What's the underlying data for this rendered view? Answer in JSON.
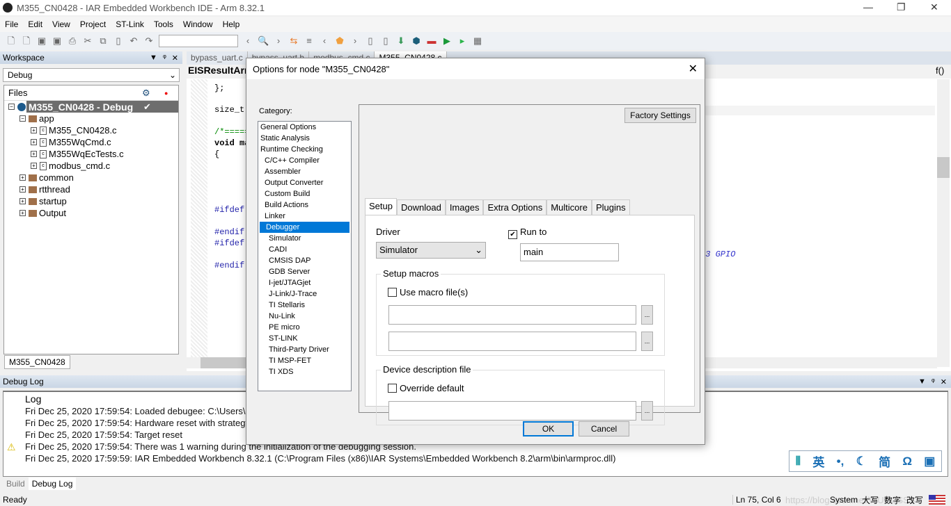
{
  "window": {
    "title": "M355_CN0428 - IAR Embedded Workbench IDE - Arm 8.32.1"
  },
  "menu": [
    "File",
    "Edit",
    "View",
    "Project",
    "ST-Link",
    "Tools",
    "Window",
    "Help"
  ],
  "workspace": {
    "title": "Workspace",
    "config": "Debug",
    "files_header": "Files",
    "tab": "M355_CN0428",
    "tree": [
      {
        "label": "M355_CN0428 - Debug",
        "level": 0,
        "kind": "project"
      },
      {
        "label": "app",
        "level": 1,
        "kind": "folder"
      },
      {
        "label": "M355_CN0428.c",
        "level": 2,
        "kind": "file"
      },
      {
        "label": "M355WqCmd.c",
        "level": 2,
        "kind": "file"
      },
      {
        "label": "M355WqEcTests.c",
        "level": 2,
        "kind": "file"
      },
      {
        "label": "modbus_cmd.c",
        "level": 2,
        "kind": "file"
      },
      {
        "label": "common",
        "level": 1,
        "kind": "folder"
      },
      {
        "label": "rtthread",
        "level": 1,
        "kind": "folder"
      },
      {
        "label": "startup",
        "level": 1,
        "kind": "folder"
      },
      {
        "label": "Output",
        "level": 1,
        "kind": "folder"
      }
    ]
  },
  "editor": {
    "tabs": [
      "bypass_uart.c",
      "bypass_uart.h",
      "modbus_cmd.c",
      "M355_CN0428.c"
    ],
    "function": "EISResultArrS",
    "code": [
      "};",
      "size_t",
      "/*=====",
      "void ma",
      "{",
      "#ifdef",
      "#endif",
      "#ifdef",
      "#endif"
    ],
    "comment_fragment": ".3 GPIO"
  },
  "dialog": {
    "title": "Options for node \"M355_CN0428\"",
    "category_label": "Category:",
    "categories": [
      {
        "label": "General Options",
        "indent": 0
      },
      {
        "label": "Static Analysis",
        "indent": 0
      },
      {
        "label": "Runtime Checking",
        "indent": 0
      },
      {
        "label": "C/C++ Compiler",
        "indent": 1
      },
      {
        "label": "Assembler",
        "indent": 1
      },
      {
        "label": "Output Converter",
        "indent": 1
      },
      {
        "label": "Custom Build",
        "indent": 1
      },
      {
        "label": "Build Actions",
        "indent": 1
      },
      {
        "label": "Linker",
        "indent": 1
      },
      {
        "label": "Debugger",
        "indent": 1,
        "selected": true
      },
      {
        "label": "Simulator",
        "indent": 2
      },
      {
        "label": "CADI",
        "indent": 2
      },
      {
        "label": "CMSIS DAP",
        "indent": 2
      },
      {
        "label": "GDB Server",
        "indent": 2
      },
      {
        "label": "I-jet/JTAGjet",
        "indent": 2
      },
      {
        "label": "J-Link/J-Trace",
        "indent": 2
      },
      {
        "label": "TI Stellaris",
        "indent": 2
      },
      {
        "label": "Nu-Link",
        "indent": 2
      },
      {
        "label": "PE micro",
        "indent": 2
      },
      {
        "label": "ST-LINK",
        "indent": 2
      },
      {
        "label": "Third-Party Driver",
        "indent": 2
      },
      {
        "label": "TI MSP-FET",
        "indent": 2
      },
      {
        "label": "TI XDS",
        "indent": 2
      }
    ],
    "factory_settings": "Factory Settings",
    "tabs": [
      "Setup",
      "Download",
      "Images",
      "Extra Options",
      "Multicore",
      "Plugins"
    ],
    "driver_label": "Driver",
    "driver_value": "Simulator",
    "run_to_label": "Run to",
    "run_to_checked": true,
    "run_to_value": "main",
    "setup_macros_label": "Setup macros",
    "use_macro_label": "Use macro file(s)",
    "use_macro_checked": false,
    "device_desc_label": "Device description file",
    "override_label": "Override default",
    "override_checked": false,
    "browse": "...",
    "ok": "OK",
    "cancel": "Cancel"
  },
  "debuglog": {
    "title": "Debug Log",
    "header": "Log",
    "lines": [
      {
        "text": "Fri Dec 25, 2020 17:59:54: Loaded debugee: C:\\Users\\",
        "warning": false
      },
      {
        "text": "Fri Dec 25, 2020 17:59:54: Hardware reset with strategy",
        "warning": false
      },
      {
        "text": "Fri Dec 25, 2020 17:59:54: Target reset",
        "warning": false
      },
      {
        "text": "Fri Dec 25, 2020 17:59:54: There was 1 warning during the initialization of the debugging session.",
        "warning": true
      },
      {
        "text": "Fri Dec 25, 2020 17:59:59: IAR Embedded Workbench 8.32.1 (C:\\Program Files (x86)\\IAR Systems\\Embedded Workbench 8.2\\arm\\bin\\armproc.dll)",
        "warning": false
      }
    ],
    "tabs": [
      "Build",
      "Debug Log"
    ]
  },
  "ime": {
    "items": [
      "英",
      "•,",
      "☾",
      "简",
      "Ω",
      "▣"
    ]
  },
  "status": {
    "ready": "Ready",
    "position": "Ln 75, Col 6",
    "encoding": "System",
    "caps": "大写",
    "num": "数字",
    "ovr": "改写",
    "watermark": "https://blog.csdn.net/WUHUSSS"
  }
}
